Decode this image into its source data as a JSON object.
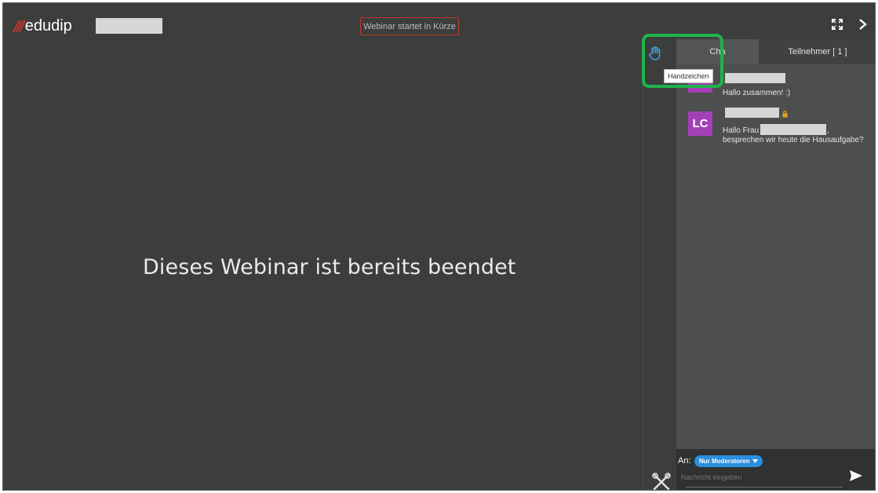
{
  "header": {
    "logo_slashes": "///",
    "logo_text": "edudip",
    "status_label": "Webinar startet in Kürze",
    "fullscreen_icon": "fullscreen-icon",
    "collapse_icon": "chevron-right-icon"
  },
  "stage": {
    "message": "Dieses Webinar ist bereits beendet"
  },
  "sidebar": {
    "tabs": [
      {
        "label": "Cha"
      },
      {
        "label": "Teilnehmer [ 1 ]"
      }
    ],
    "hand_raise": {
      "icon": "hand-icon",
      "tooltip": "Handzeichen"
    },
    "messages": [
      {
        "avatar": "",
        "lines": [
          "Hallo zusammen! :)"
        ]
      },
      {
        "avatar": "LC",
        "lines": [
          "Hallo Frau",
          "besprechen wir heute die Hausaufgabe?"
        ],
        "badge": "lock-icon",
        "tail": ","
      }
    ],
    "compose": {
      "to_label": "An:",
      "recipient": "Nur Moderatoren",
      "placeholder": "Nachricht eingeben",
      "send_icon": "send-icon"
    },
    "tools_icon": "tools-icon"
  },
  "colors": {
    "background": "#3b3e3d",
    "panel": "#4c4f4e",
    "accent": "#2a8fe0",
    "brand": "#d8322f",
    "avatar": "#a43fb8",
    "highlight": "#1fb34a"
  }
}
